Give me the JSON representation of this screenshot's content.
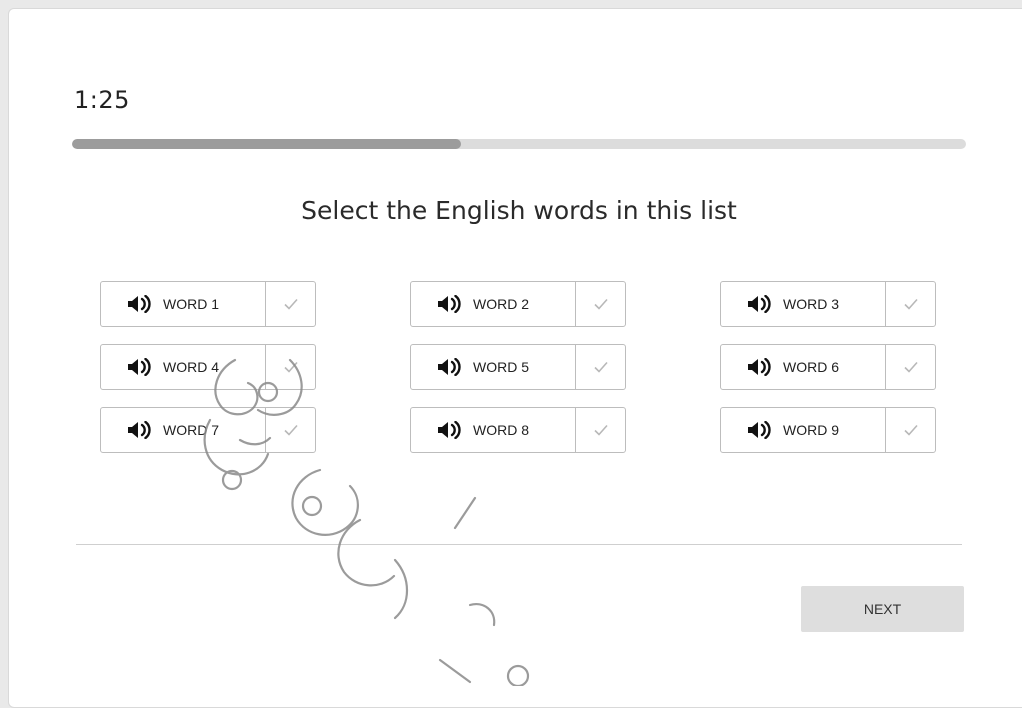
{
  "timer": {
    "value": "1:25"
  },
  "progress": {
    "fraction": 0.435,
    "fill_color": "#9c9c9c",
    "track_color": "#dcdcdc"
  },
  "prompt": {
    "text": "Select the English words in this list"
  },
  "words": [
    {
      "label": "WORD 1",
      "audio_icon": "speaker-icon",
      "check_icon": "checkmark-icon"
    },
    {
      "label": "WORD 2",
      "audio_icon": "speaker-icon",
      "check_icon": "checkmark-icon"
    },
    {
      "label": "WORD 3",
      "audio_icon": "speaker-icon",
      "check_icon": "checkmark-icon"
    },
    {
      "label": "WORD 4",
      "audio_icon": "speaker-icon",
      "check_icon": "checkmark-icon"
    },
    {
      "label": "WORD 5",
      "audio_icon": "speaker-icon",
      "check_icon": "checkmark-icon"
    },
    {
      "label": "WORD 6",
      "audio_icon": "speaker-icon",
      "check_icon": "checkmark-icon"
    },
    {
      "label": "WORD 7",
      "audio_icon": "speaker-icon",
      "check_icon": "checkmark-icon"
    },
    {
      "label": "WORD 8",
      "audio_icon": "speaker-icon",
      "check_icon": "checkmark-icon"
    },
    {
      "label": "WORD 9",
      "audio_icon": "speaker-icon",
      "check_icon": "checkmark-icon"
    }
  ],
  "footer": {
    "next_label": "NEXT"
  },
  "colors": {
    "check_color": "#b8b8b8",
    "next_bg": "#dedede",
    "border": "#bdbdbd"
  }
}
